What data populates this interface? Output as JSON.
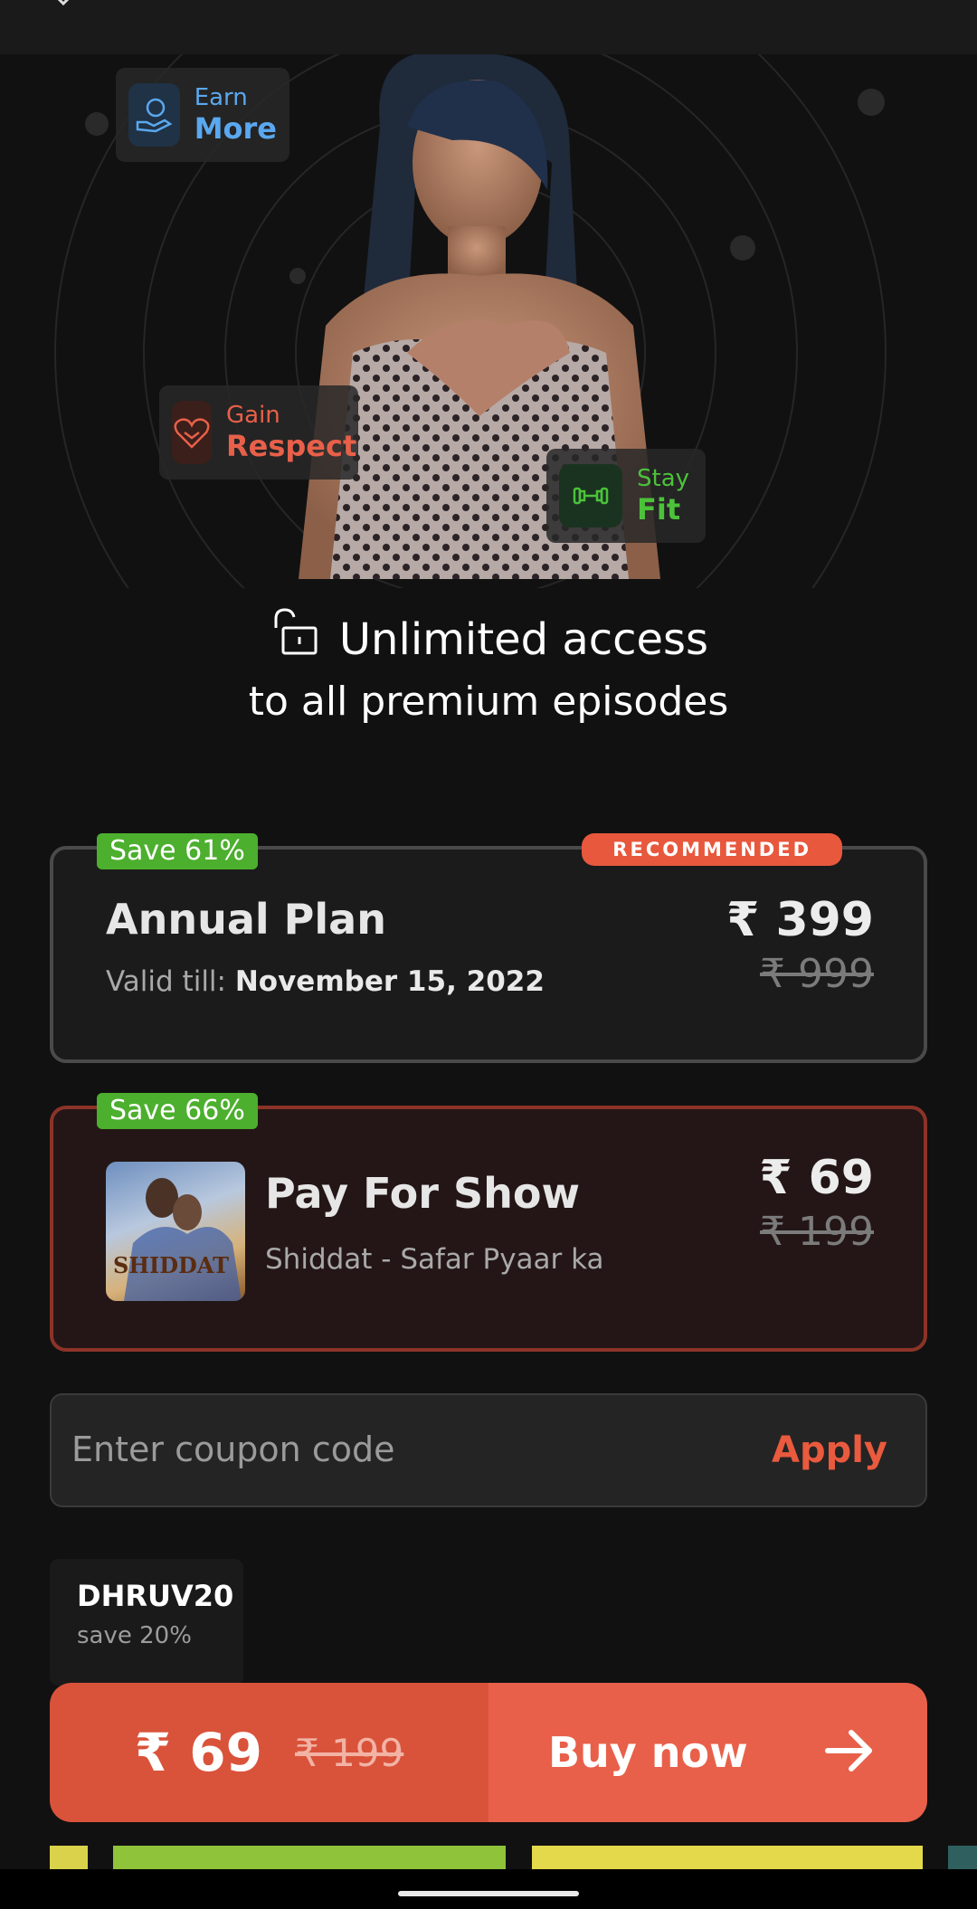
{
  "hero": {
    "chips": [
      {
        "line1": "Earn",
        "line2": "More",
        "color": "#5aa8ef"
      },
      {
        "line1": "Gain",
        "line2": "Respect",
        "color": "#e8604a"
      },
      {
        "line1": "Stay",
        "line2": "Fit",
        "color": "#4cc23a"
      }
    ],
    "headline1": "Unlimited access",
    "headline2": "to all premium episodes"
  },
  "plans": [
    {
      "save": "Save 61%",
      "badge": "RECOMMENDED",
      "title": "Annual Plan",
      "valid_label": "Valid till:",
      "valid_date": "November 15, 2022",
      "price": "₹ 399",
      "old_price": "₹ 999"
    },
    {
      "save": "Save 66%",
      "title": "Pay For Show",
      "subtitle": "Shiddat - Safar Pyaar ka",
      "thumb_text": "SHIDDAT",
      "price": "₹ 69",
      "old_price": "₹ 199"
    }
  ],
  "coupon": {
    "placeholder": "Enter coupon code",
    "apply_label": "Apply"
  },
  "suggested_coupon": {
    "code": "DHRUV20",
    "desc": "save 20%"
  },
  "buy": {
    "price": "₹ 69",
    "old_price": "₹ 199",
    "label": "Buy now"
  },
  "colors": {
    "accent": "#e8604a",
    "save_green": "#4caf2e",
    "background": "#111111"
  }
}
